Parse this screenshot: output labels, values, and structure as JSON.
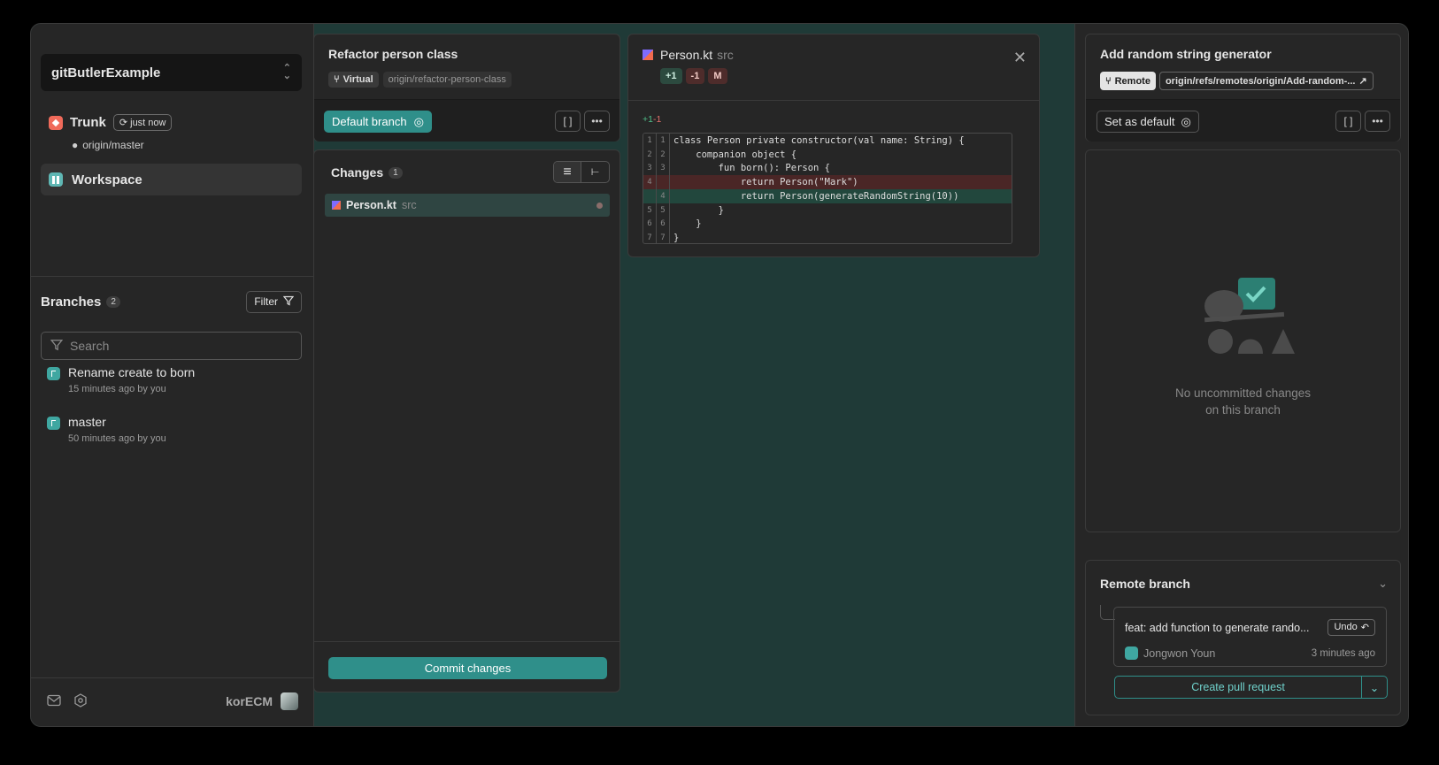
{
  "project": {
    "name": "gitButlerExample"
  },
  "trunk": {
    "label": "Trunk",
    "sync": "just now",
    "remote": "origin/master"
  },
  "workspace": {
    "label": "Workspace"
  },
  "branches": {
    "title": "Branches",
    "count": "2",
    "filter_label": "Filter",
    "search_placeholder": "Search",
    "items": [
      {
        "name": "Rename create to born",
        "meta": "15 minutes ago by you"
      },
      {
        "name": "master",
        "meta": "50 minutes ago by you"
      }
    ]
  },
  "footer": {
    "username": "korECM"
  },
  "lane1": {
    "title": "Refactor person class",
    "type_tag": "Virtual",
    "remote_tag": "origin/refactor-person-class",
    "default_button": "Default branch",
    "changes_title": "Changes",
    "changes_count": "1",
    "file": {
      "name": "Person.kt",
      "dir": "src"
    },
    "commit_button": "Commit changes"
  },
  "file_view": {
    "name": "Person.kt",
    "dir": "src",
    "badges": {
      "added": "+1",
      "removed": "-1",
      "status": "M"
    },
    "hunk_added": "+1",
    "hunk_removed": "-1",
    "lines": [
      {
        "old": "1",
        "new": "1",
        "text": "class Person private constructor(val name: String) {",
        "kind": "ctx"
      },
      {
        "old": "2",
        "new": "2",
        "text": "    companion object {",
        "kind": "ctx"
      },
      {
        "old": "3",
        "new": "3",
        "text": "        fun born(): Person {",
        "kind": "ctx"
      },
      {
        "old": "4",
        "new": "",
        "text": "            return Person(\"Mark\")",
        "kind": "del"
      },
      {
        "old": "",
        "new": "4",
        "text": "            return Person(generateRandomString(10))",
        "kind": "add"
      },
      {
        "old": "5",
        "new": "5",
        "text": "        }",
        "kind": "ctx"
      },
      {
        "old": "6",
        "new": "6",
        "text": "    }",
        "kind": "ctx"
      },
      {
        "old": "7",
        "new": "7",
        "text": "}",
        "kind": "ctx"
      }
    ]
  },
  "lane2": {
    "title": "Add random string generator",
    "type_tag": "Remote",
    "remote_tag": "origin/refs/remotes/origin/Add-random-...",
    "set_default": "Set as default",
    "empty_line1": "No uncommitted changes",
    "empty_line2": "on this branch",
    "remote_branch_title": "Remote branch",
    "commit": {
      "message": "feat: add function to generate rando...",
      "undo": "Undo",
      "author": "Jongwon Youn",
      "time": "3 minutes ago"
    },
    "pr_button": "Create pull request"
  },
  "colors": {
    "accent": "#2f8f8a",
    "background": "#1f3a37",
    "panel": "#262626",
    "added": "#22473d",
    "removed": "#4a2626"
  }
}
